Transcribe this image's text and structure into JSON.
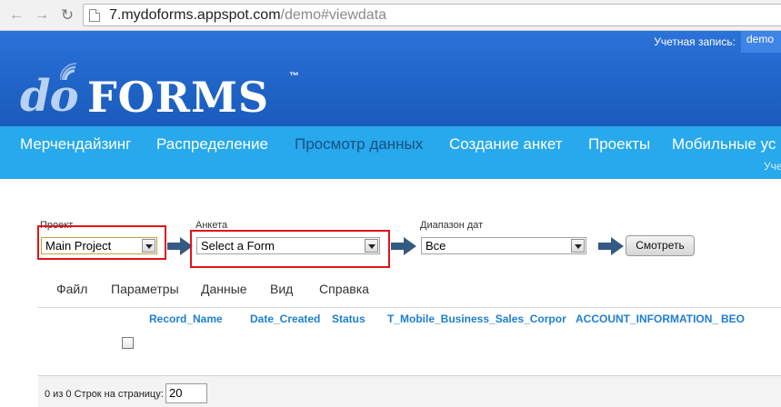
{
  "browser": {
    "url_main": "7.mydoforms.appspot.com",
    "url_tail": "/demo#viewdata"
  },
  "header": {
    "account_label": "Учетная запись:",
    "account_name": "demo",
    "logo_do": "do",
    "logo_forms": "FORMS",
    "logo_tm": "™"
  },
  "nav": {
    "items": [
      {
        "label": "Мерчендайзинг"
      },
      {
        "label": "Распределение"
      },
      {
        "label": "Просмотр данных"
      },
      {
        "label": "Создание анкет"
      },
      {
        "label": "Проекты"
      },
      {
        "label": "Мобильные ус"
      }
    ],
    "active": "Просмотр данных",
    "sub_text": "Уче"
  },
  "filters": {
    "project_label": "Проект",
    "project_value": "Main Project",
    "form_label": "Анкета",
    "form_value": "Select a Form",
    "date_label": "Диапазон дат",
    "date_value": "Все",
    "view_button": "Смотреть"
  },
  "menu": {
    "items": [
      "Файл",
      "Параметры",
      "Данные",
      "Вид",
      "Справка"
    ]
  },
  "table": {
    "columns": [
      "Record_Name",
      "Date_Created",
      "Status",
      "T_Mobile_Business_Sales_Corpor",
      "ACCOUNT_INFORMATION_",
      "BEO"
    ]
  },
  "pager": {
    "text": "0 из 0 Строк на страницу:",
    "page_size": "20"
  },
  "colors": {
    "header_blue": "#1f63c6",
    "nav_blue": "#27a9ec",
    "highlight_red": "#e4121a",
    "arrow_navy": "#345a84",
    "column_link": "#1e7ed2"
  }
}
